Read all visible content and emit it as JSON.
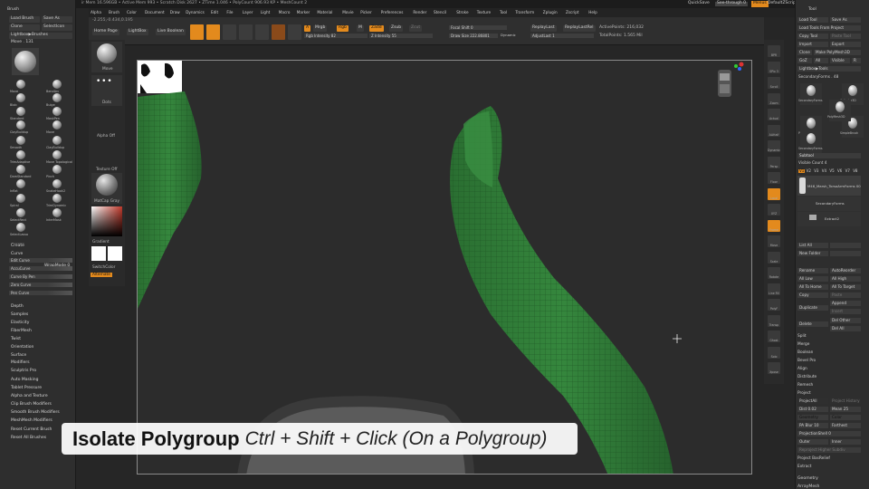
{
  "app": {
    "title": "ZBrush 2022",
    "status_line": "ir Mem 16.596GB • Active Mem 993 • Scratch Disk 2627 • ZTime 1.046 • PolyCount 906.93 KP • MeshCount 2"
  },
  "topbar": {
    "quicksave": "QuickSave",
    "spotlight": "See-through 0",
    "menus_btn": "Menus",
    "script": "DefaultZScript"
  },
  "menubar": [
    "Alpha",
    "Brush",
    "Color",
    "Document",
    "Draw",
    "Dynamics",
    "Edit",
    "File",
    "Layer",
    "Light",
    "Macro",
    "Marker",
    "Material",
    "Movie",
    "Picker",
    "Preferences",
    "Render",
    "Stencil",
    "Stroke",
    "Texture",
    "Tool",
    "Transform",
    "Zplugin",
    "Zscript",
    "Help"
  ],
  "toolbar": {
    "home_page": "Home Page",
    "lightbox": "LightBox",
    "live_boolean": "Live Boolean",
    "coords": "-2.255,-0.434,0.195",
    "icons": [
      "Edit",
      "Draw",
      "Move",
      "Scale",
      "Rotate"
    ],
    "mrgb": "Mrgb",
    "rgb": "Rgb",
    "m": "M",
    "zadd": "Zadd",
    "zsub": "Zsub",
    "zcut": "Zcut",
    "a_label": "A",
    "rgb_intensity": "Rgb Intensity 82",
    "z_intensity": "Z Intensity 55",
    "focal_shift": "Focal Shift 0",
    "draw_size": "Draw Size 222.86801",
    "dynamic": "Dynamic",
    "replay_last": "ReplayLast",
    "replay_last_rel": "ReplayLastRel",
    "adjust_last": "AdjustLast 1",
    "active_points": "ActivePoints: 216,032",
    "total_points": "TotalPoints: 1.565 Mil"
  },
  "left_panel": {
    "header": "Brush",
    "load_brush": "Load Brush",
    "save_as": "Save As",
    "clone": "Clone",
    "select_icon": "SelectIcon",
    "lightbox_brushes": "Lightbox▶Brushes",
    "move_label": "Move . 131",
    "brushes": [
      "Move",
      "BendArc",
      "Blob",
      "Bulge",
      "Standard",
      "MaskPen",
      "ClayBuildup",
      "Move",
      "Smooth",
      "ClayBuildup",
      "TrimAdaptive",
      "Move Topological",
      "DamStandard",
      "Pinch",
      "Inflat",
      "SnakeHook2",
      "Spiral",
      "TrimDynamic",
      "SelectRect",
      "InterMask",
      "SelectLasso"
    ],
    "sections": [
      "Create",
      "Curve",
      "Depth",
      "Samples",
      "Elasticity",
      "FiberMesh",
      "Twist",
      "Orientation",
      "Surface",
      "Modifiers",
      "Sculptris Pro",
      "Auto Masking",
      "Tablet Pressure",
      "Alpha and Texture",
      "Clip Brush Modifiers",
      "Smooth Brush Modifiers",
      "MeshMesh Modifiers"
    ],
    "curve_sliders": [
      "Edit Curve",
      "AccuCurve",
      "Curve By Pen",
      "Zero Curve",
      "Pen Curve"
    ],
    "wrap_mode": "WrapMode 0",
    "reset_current": "Reset Current Brush",
    "reset_all": "Reset All Brushes"
  },
  "left_shelf": {
    "move": "Move",
    "dots": "Dots",
    "alpha_off": "Alpha Off",
    "texture_off": "Texture Off",
    "material": "MatCap Gray",
    "gradient": "Gradient",
    "switch_color": "SwitchColor",
    "alternate": "Alternate"
  },
  "right_shelf": [
    "BPR",
    "SPix 3",
    "Scroll",
    "Zoom",
    "Actual",
    "AAHalf",
    "Dynamic",
    "Persp",
    "Floor",
    "Local",
    "XYZ",
    "Frame",
    "Move",
    "Scale",
    "Rotate",
    "Line Fill",
    "PolyF",
    "Transp",
    "Ghost",
    "Solo",
    "Xpose"
  ],
  "right_panel": {
    "header": "Tool",
    "load_tool": "Load Tool",
    "save_as": "Save As",
    "load_from_project": "Load Tools From Project",
    "copy_tool": "Copy Tool",
    "paste_tool": "Paste Tool",
    "import": "Import",
    "export": "Export",
    "clone": "Clone",
    "make_polymesh": "Make PolyMesh3D",
    "goz": "GoZ",
    "all": "All",
    "visible": "Visible",
    "r": "R",
    "lightbox_tools": "Lightbox▶Tools",
    "secondary_forms": "SecondaryForms . 48",
    "tool_names": [
      "SecondaryForms",
      "Cylinder3D",
      "PolySphere",
      "SimpleBrush",
      "SecondaryForms",
      "PolyMesh3D"
    ],
    "subtool_header": "Subtool",
    "visible_count": "Visible Count 4",
    "levels": [
      "V1",
      "V2",
      "V3",
      "V4",
      "V5",
      "V6",
      "V7",
      "V8"
    ],
    "subtools": [
      "M46_Marsh_TorsoArmForms 00",
      "SecondaryForms",
      "Extract2"
    ],
    "list_all": "List All",
    "new_folder": "New Folder",
    "ops": [
      "Rename",
      "AutoReorder",
      "All Low",
      "All High",
      "All To Home",
      "All To Target",
      "Copy",
      "Paste",
      "Duplicate",
      "Append",
      "Insert",
      "Delete",
      "Del Other",
      "Del All",
      "Split",
      "Merge",
      "Boolean",
      "Bevel Pro",
      "Align",
      "Distribute",
      "Remesh",
      "Project"
    ],
    "project_all": "ProjectAll",
    "project_history": "Project History",
    "dist": "Dist 0.02",
    "mean": "Mean 25",
    "geometry_btn": "Geometry",
    "color_btn": "Color",
    "pa_blur": "PA Blur 10",
    "farthest": "Farthest",
    "projection_shell": "ProjectionShell 0",
    "outer": "Outer",
    "inner": "Inner",
    "reproject_higher": "Reproject Higher Subdiv",
    "project_bas_relief": "Project BasRelief",
    "extract": "Extract",
    "geometry": "Geometry",
    "array_mesh": "ArrayMesh"
  },
  "caption": {
    "title": "Isolate Polygroup",
    "shortcut": "Ctrl + Shift + Click (On a Polygroup)"
  },
  "colors": {
    "accent": "#e38a1d",
    "mesh": "#2f7a38",
    "panel": "#2e2e2e"
  }
}
